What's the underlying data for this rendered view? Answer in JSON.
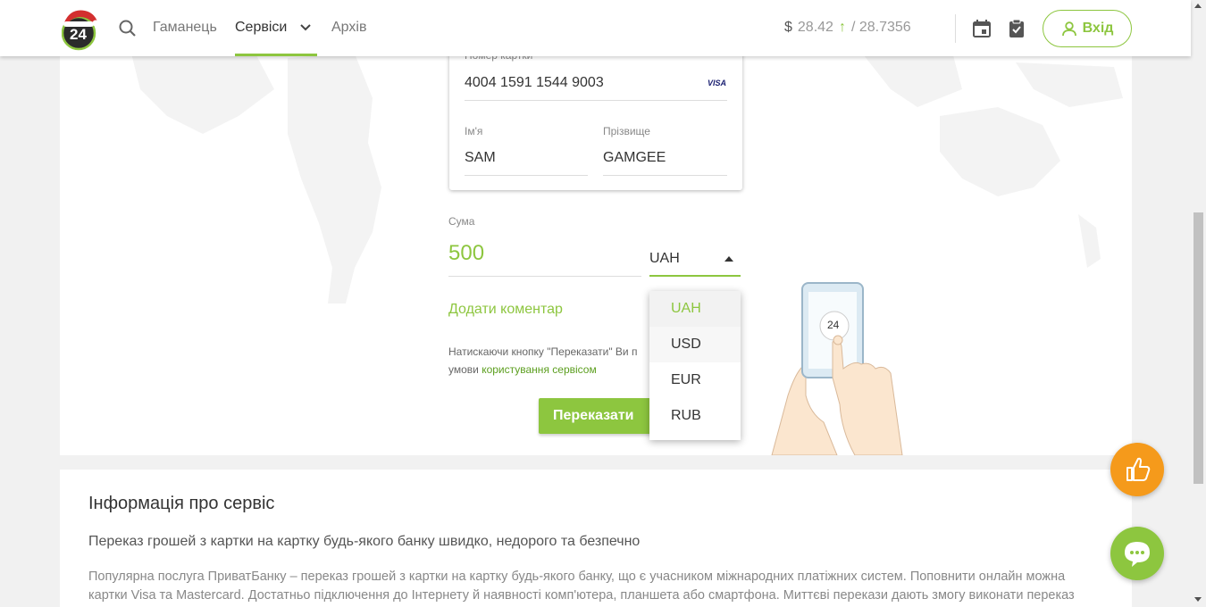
{
  "header": {
    "logo_text": "24",
    "nav": {
      "wallet": "Гаманець",
      "services": "Сервіси",
      "archive": "Архів"
    },
    "rate": {
      "currency_symbol": "$",
      "buy": "28.42",
      "sell": "/ 28.7356"
    },
    "login_label": "Вхід"
  },
  "form": {
    "card_number_label": "Номер картки",
    "card_number": "4004 1591 1544 9003",
    "card_brand": "VISA",
    "first_name_label": "Ім'я",
    "first_name": "SAM",
    "last_name_label": "Прізвище",
    "last_name": "GAMGEE",
    "amount_label": "Сума",
    "amount": "500",
    "currency": "UAH",
    "currency_options": [
      "UAH",
      "USD",
      "EUR",
      "RUB"
    ],
    "add_comment": "Додати коментар",
    "terms_prefix": "Натискаючи кнопку \"Переказати\" Ви п",
    "terms_line2": "умови ",
    "terms_link": "користування сервісом",
    "submit": "Переказати"
  },
  "illustration": {
    "phone_badge": "24"
  },
  "info": {
    "title": "Інформація про сервіс",
    "subtitle": "Переказ грошей з картки на картку будь-якого банку швидко, недорого та безпечно",
    "body": "Популярна послуга ПриватБанку – переказ грошей з картки на картку будь-якого банку, що є учасником міжнародних платіжних систем. Поповнити онлайн можна картки Visa та Mastercard. Достатньо підключення до Інтернету й наявності комп'ютера, планшета або смартфона. Миттєві перекази дають змогу виконати переказ"
  },
  "colors": {
    "accent": "#8dc63f",
    "like": "#f59a1b"
  },
  "icons": {
    "search": "search-icon",
    "calendar": "calendar-icon",
    "clipboard": "clipboard-check-icon",
    "user": "user-icon",
    "like": "thumbs-up-icon",
    "chat": "chat-bubble-icon"
  }
}
